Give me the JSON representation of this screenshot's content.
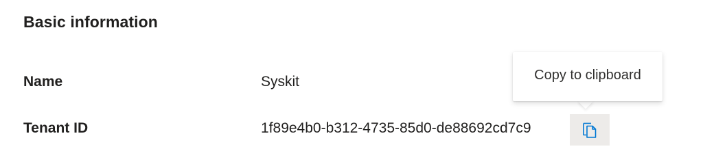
{
  "section": {
    "title": "Basic information"
  },
  "rows": [
    {
      "label": "Name",
      "value": "Syskit"
    },
    {
      "label": "Tenant ID",
      "value": "1f89e4b0-b312-4735-85d0-de88692cd7c9"
    }
  ],
  "copy_button": {
    "icon": "copy-icon",
    "tooltip": "Copy to clipboard"
  },
  "colors": {
    "accent": "#0078d4",
    "button_hover_bg": "#edebe9",
    "text": "#201f1e"
  }
}
